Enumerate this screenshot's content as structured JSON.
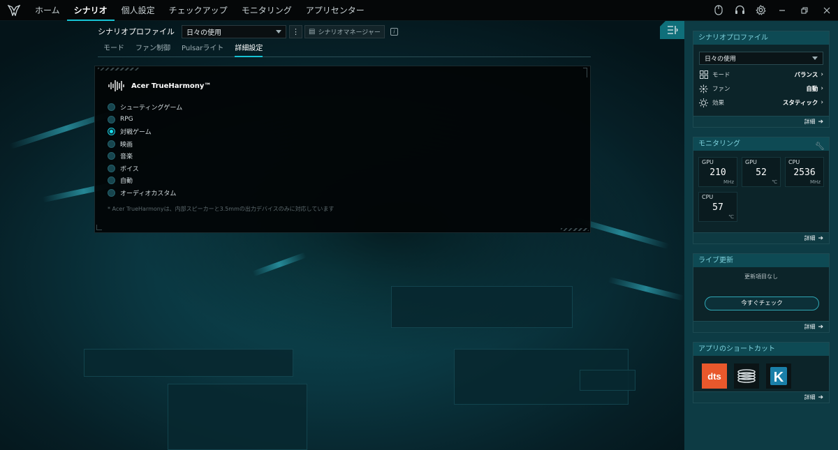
{
  "nav": {
    "items": [
      "ホーム",
      "シナリオ",
      "個人設定",
      "チェックアップ",
      "モニタリング",
      "アプリセンター"
    ],
    "active_index": 1
  },
  "top_icons": [
    "mouse-icon",
    "headset-icon",
    "gear-icon",
    "minimize-icon",
    "restore-icon",
    "close-icon"
  ],
  "profile": {
    "label": "シナリオプロファイル",
    "selected": "日々の使用",
    "manager_label": "シナリオマネージャー"
  },
  "subtabs": [
    "モード",
    "ファン制御",
    "Pulsarライト",
    "詳細設定"
  ],
  "active_subtab": 3,
  "trueharmony": {
    "title": "Acer TrueHarmony™",
    "options": [
      "シューティングゲーム",
      "RPG",
      "対戦ゲーム",
      "映画",
      "音楽",
      "ボイス",
      "自動",
      "オーディオカスタム"
    ],
    "selected_index": 2,
    "note": "* Acer TrueHarmonyは、内部スピーカーと3.5mmの出力デバイスのみに対応しています"
  },
  "sidebar": {
    "scenario": {
      "title": "シナリオプロファイル",
      "selected": "日々の使用",
      "rows": [
        {
          "icon": "grid-icon",
          "label": "モード",
          "value": "バランス"
        },
        {
          "icon": "fan-icon",
          "label": "ファン",
          "value": "自動"
        },
        {
          "icon": "sun-icon",
          "label": "効果",
          "value": "スタティック"
        }
      ],
      "detail": "詳細"
    },
    "monitoring": {
      "title": "モニタリング",
      "tiles": [
        {
          "label": "GPU",
          "value": "210",
          "unit": "MHz"
        },
        {
          "label": "GPU",
          "value": "52",
          "unit": "℃"
        },
        {
          "label": "CPU",
          "value": "2536",
          "unit": "MHz"
        },
        {
          "label": "CPU",
          "value": "57",
          "unit": "℃"
        }
      ],
      "detail": "詳細"
    },
    "live": {
      "title": "ライブ更新",
      "empty": "更新項目なし",
      "button": "今すぐチェック",
      "detail": "詳細"
    },
    "shortcuts": {
      "title": "アプリのショートカット",
      "apps": [
        {
          "name": "dts-app-icon",
          "text": "dts"
        },
        {
          "name": "coil-app-icon",
          "text": ""
        },
        {
          "name": "k-app-icon",
          "text": "K"
        }
      ],
      "detail": "詳細"
    }
  },
  "colors": {
    "accent": "#17c3d4",
    "sidebar_bg": "#0d3b44",
    "dts": "#e8582c"
  }
}
